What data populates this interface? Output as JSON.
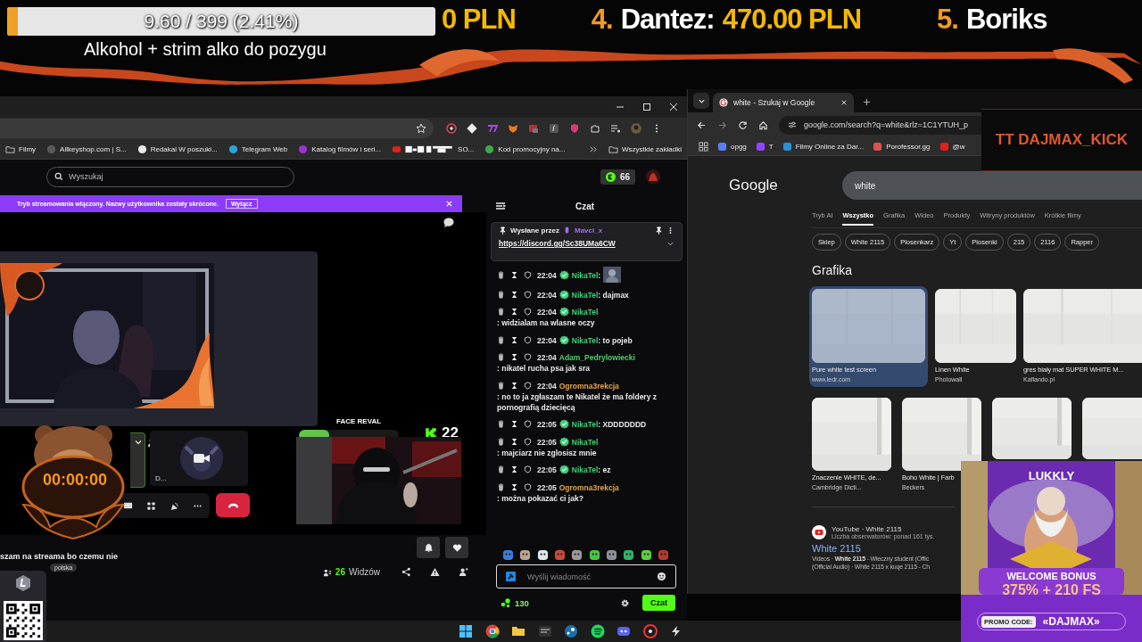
{
  "goal": {
    "text": "9.60 / 399 (2.41%)",
    "level": 0.0241
  },
  "goal_title": "Alkohol + strim alko do pozygu",
  "ticker": [
    {
      "amount": "0 PLN"
    },
    {
      "rank": "4.",
      "name": "Dantez:",
      "amount": "470.00 PLN"
    },
    {
      "rank": "5.",
      "name": "Boriks"
    }
  ],
  "left_browser": {
    "bookmarks": [
      {
        "kind": "folder",
        "label": "Filmy"
      },
      {
        "kind": "site",
        "color": "#5a5a5a",
        "label": "Allkeyshop.com | S..."
      },
      {
        "kind": "site",
        "color": "#e8e8e8",
        "label": "Redakai W poszuki..."
      },
      {
        "kind": "site",
        "color": "#2aa3e0",
        "label": "Telegram Web"
      },
      {
        "kind": "site",
        "color": "#9b30d9",
        "label": "Katalog filmów i seri..."
      },
      {
        "kind": "censored",
        "color": "#e62117",
        "label": "SO..."
      },
      {
        "kind": "site",
        "color": "#3ea84a",
        "label": "Kod promocyjny na..."
      }
    ],
    "all_bookmarks": "Wszystkie zakładki"
  },
  "kick": {
    "search_placeholder": "Wyszukaj",
    "balance": "66",
    "banner": {
      "text": "Tryb streamowania włączony. Nazwy użytkownika zostały skrócone.",
      "button": "Wyłącz"
    },
    "call": {
      "tile_label": "D...",
      "timer": "00:00:00"
    },
    "face_reval": {
      "title": "FACE REVAL",
      "level": 0.3,
      "count": "22"
    },
    "stream": {
      "title": "szam na streama bo czemu nie",
      "tags": [
        "polska"
      ],
      "viewers": "26",
      "viewers_label": "Widzów"
    },
    "chat": {
      "title": "Czat",
      "pinned": {
        "label": "Wysłane przez",
        "user": "Mavci_x",
        "link": "https://discord.gg/Sc38UMa6CW"
      },
      "messages": [
        {
          "kind": "emote",
          "time": "22:04",
          "user": "NikaTel",
          "color": "#3ed17a",
          "verified": true,
          "text": ":"
        },
        {
          "kind": "text",
          "time": "22:04",
          "user": "NikaTel",
          "color": "#3ed17a",
          "verified": true,
          "text": ": dajmax"
        },
        {
          "kind": "text",
          "time": "22:04",
          "user": "NikaTel",
          "color": "#3ed17a",
          "verified": true,
          "text": ": widzialam na wlasne oczy"
        },
        {
          "kind": "text",
          "time": "22:04",
          "user": "NikaTel",
          "color": "#3ed17a",
          "verified": true,
          "text": ": to pojeb"
        },
        {
          "kind": "text",
          "time": "22:04",
          "user": "Adam_Pedrylowiecki",
          "color": "#4fcf6a",
          "verified": false,
          "text": ": nikatel rucha psa jak sra"
        },
        {
          "kind": "text",
          "time": "22:04",
          "user": "Ogromna3rekcja",
          "color": "#e3a54a",
          "verified": false,
          "text": ": no to ja zgłaszam te Nikatel że ma foldery z pornografią dziecięcą"
        },
        {
          "kind": "text",
          "time": "22:05",
          "user": "NikaTel",
          "color": "#3ed17a",
          "verified": true,
          "text": ": XDDDDDDD"
        },
        {
          "kind": "text",
          "time": "22:05",
          "user": "NikaTel",
          "color": "#3ed17a",
          "verified": true,
          "text": ": majciarz nie zglosisz mnie"
        },
        {
          "kind": "text",
          "time": "22:05",
          "user": "NikaTel",
          "color": "#3ed17a",
          "verified": true,
          "text": ": ez"
        },
        {
          "kind": "text",
          "time": "22:05",
          "user": "Ogromna3rekcja",
          "color": "#e3a54a",
          "verified": false,
          "text": ": można pokazać ci jak?"
        }
      ],
      "input_placeholder": "Wyślij wiadomość",
      "points": "130",
      "send": "Czat"
    }
  },
  "right_browser": {
    "tab": "white - Szukaj w Google",
    "url": "google.com/search?q=white&rlz=1C1YTUH_p",
    "bookmarks": [
      {
        "color": "#5b7cf0",
        "label": "opgg"
      },
      {
        "color": "#9146ff",
        "label": "T"
      },
      {
        "color": "#2b8fd6",
        "label": "Filmy Online za Dar..."
      },
      {
        "color": "#d9534f",
        "label": "Porofessor.gg"
      },
      {
        "color": "#e02020",
        "label": "@w"
      }
    ],
    "google": {
      "logo": "Google",
      "query": "white",
      "tabs": [
        {
          "label": "Tryb AI",
          "selected": false
        },
        {
          "label": "Wszystko",
          "selected": true
        },
        {
          "label": "Grafika",
          "selected": false
        },
        {
          "label": "Wideo",
          "selected": false
        },
        {
          "label": "Produkty",
          "selected": false
        },
        {
          "label": "Witryny produktów",
          "selected": false
        },
        {
          "label": "Krótkie filmy",
          "selected": false
        }
      ],
      "chips": [
        "Sklep",
        "White 2115",
        "Piosenkarz",
        "Yt",
        "Piosenki",
        "215",
        "2116",
        "Rapper"
      ],
      "images_heading": "Grafika",
      "images": [
        {
          "title": "Pure white test screen",
          "source": "www.ledr.com",
          "selected": true
        },
        {
          "title": "Linen White",
          "source": "Photowall",
          "selected": false
        },
        {
          "title": "gres biały mat SUPER WHITE M...",
          "source": "Kaflando.pl",
          "selected": false
        },
        {
          "title": "Znaczenie WHITE, de...",
          "source": "Cambridge Dicti...",
          "selected": false
        },
        {
          "title": "Boho White | Farb",
          "source": "Beckers",
          "selected": false
        },
        {
          "selected": false
        },
        {
          "selected": false
        }
      ],
      "result": {
        "site": "YouTube · White 2115",
        "meta": "Liczba obserwatorów: ponad 161 tys.",
        "title": "White 2115",
        "snippet": [
          "Videos · **White 2115** - Wieczny student (Offic",
          "(Official Audio) · White 2115 x kuqe 2115 - Ch"
        ]
      }
    }
  },
  "overlay_tag": "TT DAJMAX_KICK",
  "ad": {
    "brand": "LUKKLY",
    "headline": "WELCOME BONUS",
    "offer": "375% + 210 FS",
    "promo_label": "PROMO CODE:",
    "promo_code": "«DAJMAX»"
  }
}
